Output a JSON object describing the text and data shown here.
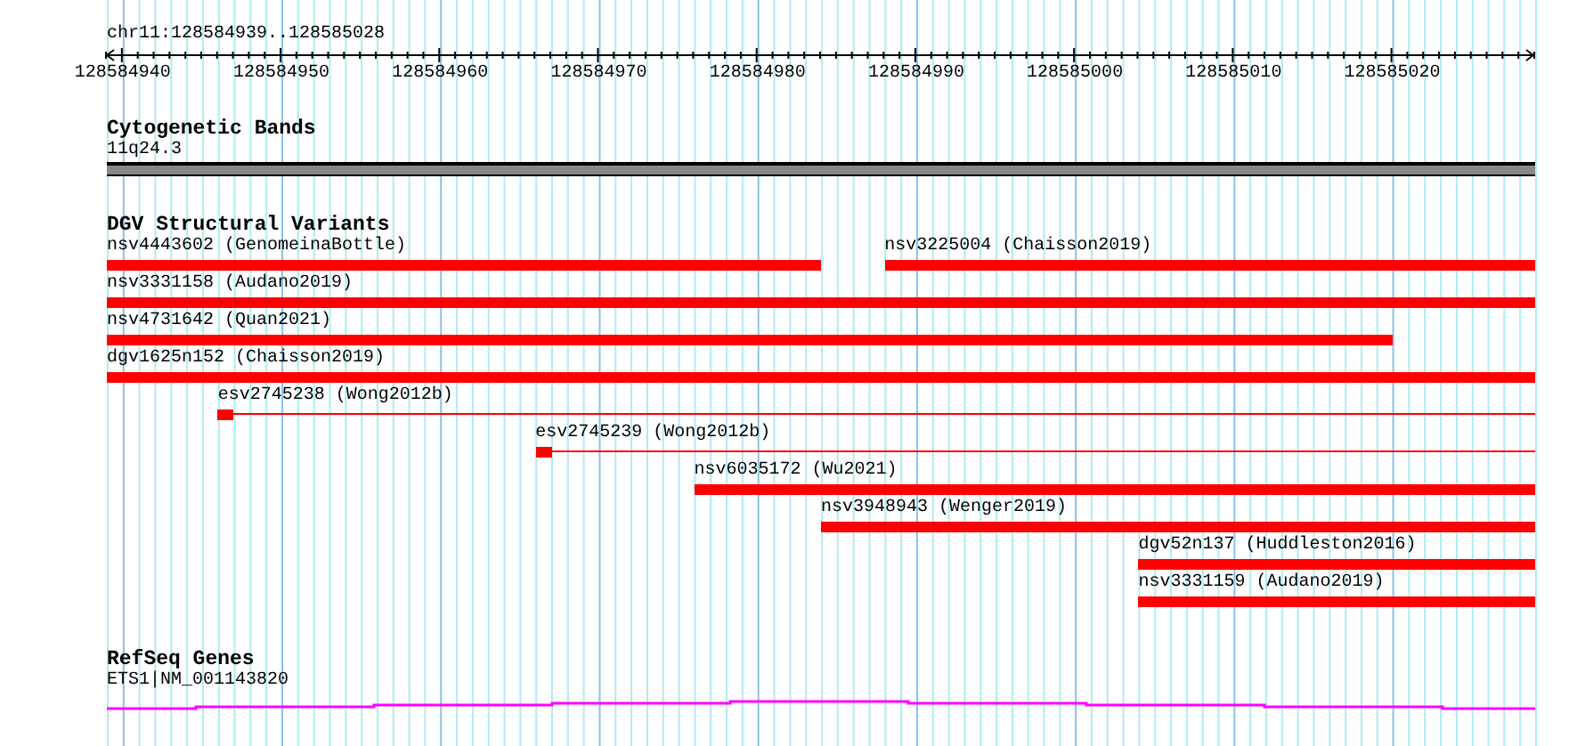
{
  "locus": "chr11:128584939..128585028",
  "ruler": {
    "ticks": [
      "128584940",
      "128584950",
      "128584960",
      "128584970",
      "128584980",
      "128584990",
      "128585000",
      "128585010",
      "128585020"
    ]
  },
  "tracks": [
    {
      "kind": "bands",
      "title": "Cytogenetic Bands",
      "band": {
        "label": "11q24.3"
      }
    },
    {
      "kind": "features",
      "title": "DGV Structural Variants",
      "rows": [
        [
          {
            "kind": "block",
            "label": "nsv4443602 (GenomeinaBottle)"
          },
          {
            "kind": "block",
            "label": "nsv3225004 (Chaisson2019)"
          }
        ],
        [
          {
            "kind": "block",
            "label": "nsv3331158 (Audano2019)"
          }
        ],
        [
          {
            "kind": "block",
            "label": "nsv4731642 (Quan2021)"
          }
        ],
        [
          {
            "kind": "block",
            "label": "dgv1625n152 (Chaisson2019)"
          }
        ],
        [
          {
            "kind": "tailed",
            "label": "esv2745238 (Wong2012b)"
          }
        ],
        [
          {
            "kind": "tailed",
            "label": "esv2745239 (Wong2012b)"
          }
        ],
        [
          {
            "kind": "block",
            "label": "nsv6035172 (Wu2021)"
          }
        ],
        [
          {
            "kind": "block",
            "label": "nsv3948943 (Wenger2019)"
          }
        ],
        [
          {
            "kind": "block",
            "label": "dgv52n137 (Huddleston2016)"
          }
        ],
        [
          {
            "kind": "block",
            "label": "nsv3331159 (Audano2019)"
          }
        ]
      ]
    },
    {
      "kind": "genes",
      "title": "RefSeq Genes",
      "gene": {
        "label": "ETS1|NM_001143820"
      }
    }
  ]
}
